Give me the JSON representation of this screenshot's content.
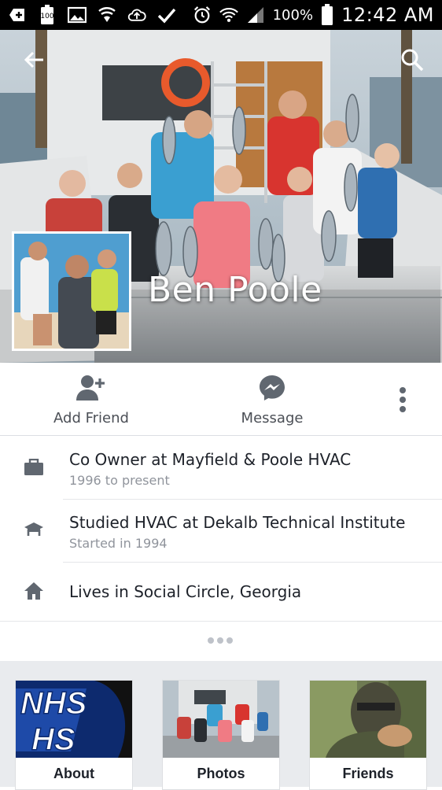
{
  "status_bar": {
    "battery_badge": "100",
    "battery_percent": "100%",
    "time": "12:42 AM",
    "icons": [
      "notification-plus-icon",
      "battery-saver-icon",
      "gallery-icon",
      "shield-icon",
      "cloud-upload-icon",
      "check-icon",
      "alarm-icon",
      "wifi-icon",
      "signal-icon",
      "battery-icon"
    ]
  },
  "header": {
    "back_icon": "back-arrow-icon",
    "search_icon": "search-icon"
  },
  "profile": {
    "name": "Ben Poole"
  },
  "actions": {
    "add_friend": "Add Friend",
    "message": "Message",
    "more_icon": "more-vertical-icon"
  },
  "info": [
    {
      "icon": "briefcase-icon",
      "main": "Co Owner at Mayfield & Poole HVAC",
      "sub": "1996 to present"
    },
    {
      "icon": "graduation-cap-icon",
      "main": "Studied HVAC at Dekalb Technical Institute",
      "sub": "Started in 1994"
    },
    {
      "icon": "home-icon",
      "main": "Lives in Social Circle, Georgia",
      "sub": ""
    }
  ],
  "tiles": [
    {
      "label": "About"
    },
    {
      "label": "Photos"
    },
    {
      "label": "Friends"
    }
  ],
  "colors": {
    "accent": "#4267b2",
    "text_primary": "#1d2129",
    "text_secondary": "#90949c",
    "icon_gray": "#606770",
    "tile_bg": "#e9ebee"
  }
}
